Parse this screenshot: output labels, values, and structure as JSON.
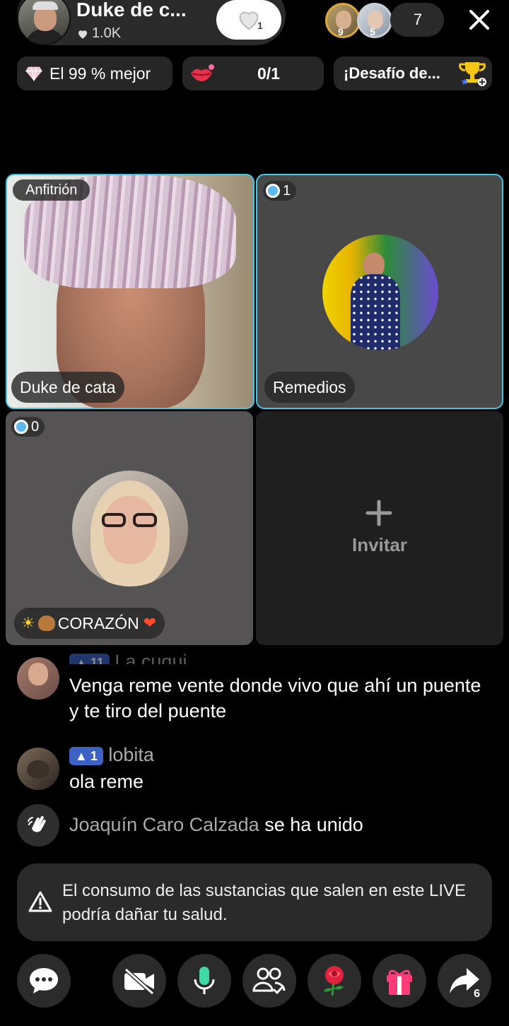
{
  "header": {
    "host_name": "Duke de c...",
    "host_likes": "1.0K",
    "follow_count": "1",
    "top_viewers": [
      {
        "badge": "9"
      },
      {
        "badge": "5"
      }
    ],
    "viewer_count": "7"
  },
  "chips": {
    "rank_label": "El 99 % mejor",
    "goal_progress": "0/1",
    "challenge_label": "¡Desafío de..."
  },
  "grid": {
    "host_tag": "Anfitrión",
    "host_label": "Duke de cata",
    "guest1_score": "1",
    "guest1_label": "Remedios",
    "guest2_score": "0",
    "guest2_label": "CORAZÓN",
    "invite_label": "Invitar"
  },
  "chat": [
    {
      "level": "11",
      "user": "La cuqui",
      "message": "Venga reme vente donde vivo que ahí un puente y te tiro del puente"
    },
    {
      "level": "1",
      "user": "lobita",
      "message": "ola reme"
    },
    {
      "user": "Joaquín Caro Calzada",
      "message": "se ha unido"
    }
  ],
  "warning": "El consumo de las sustancias que salen en este LIVE podría dañar tu salud.",
  "bottom_bar": {
    "share_count": "6"
  },
  "colors": {
    "live_border": "#43c7e6",
    "level_badge": "#3c63c4",
    "mic": "#3fd8a6",
    "gift": "#ff3b7a"
  }
}
